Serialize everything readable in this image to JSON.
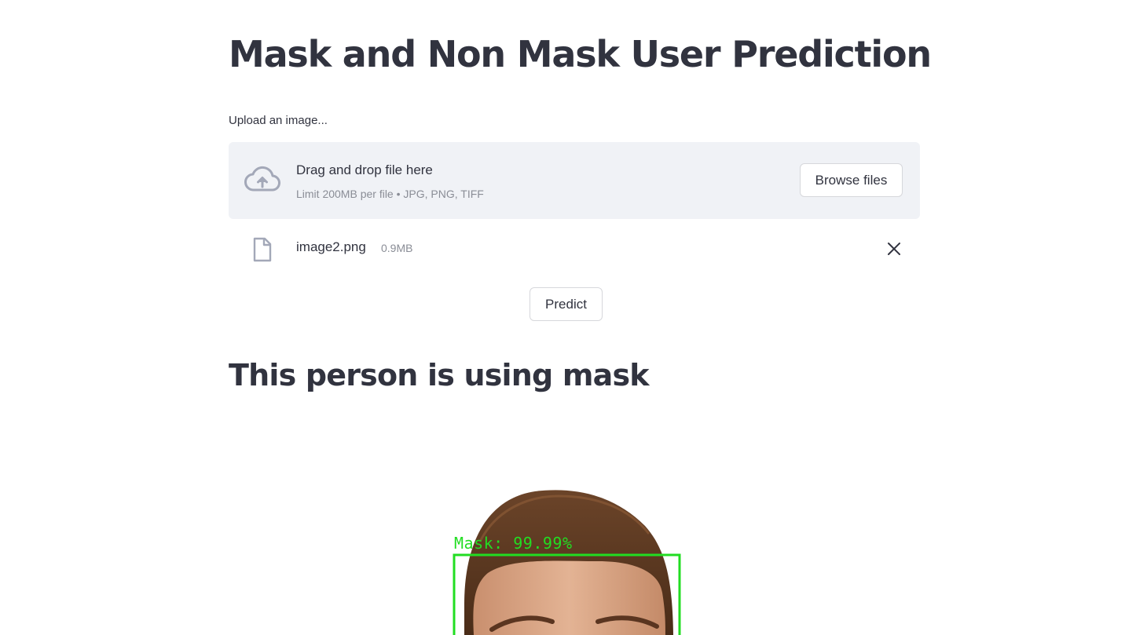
{
  "page": {
    "title": "Mask and Non Mask User Prediction"
  },
  "uploader": {
    "label": "Upload an image...",
    "drop_text": "Drag and drop file here",
    "limit_text": "Limit 200MB per file • JPG, PNG, TIFF",
    "browse_label": "Browse files",
    "icon": "cloud-upload-icon"
  },
  "uploaded_file": {
    "name": "image2.png",
    "size": "0.9MB",
    "icon": "file-icon",
    "remove_icon": "close-icon"
  },
  "predict_button": {
    "label": "Predict"
  },
  "result": {
    "heading": "This person is using mask",
    "detection_label": "Mask: 99.99%",
    "box_color": "#22dd22"
  },
  "colors": {
    "text": "#31333f",
    "dropzone_bg": "#f0f2f6",
    "muted": "#8a8d96",
    "icon": "#a3a8b8"
  }
}
